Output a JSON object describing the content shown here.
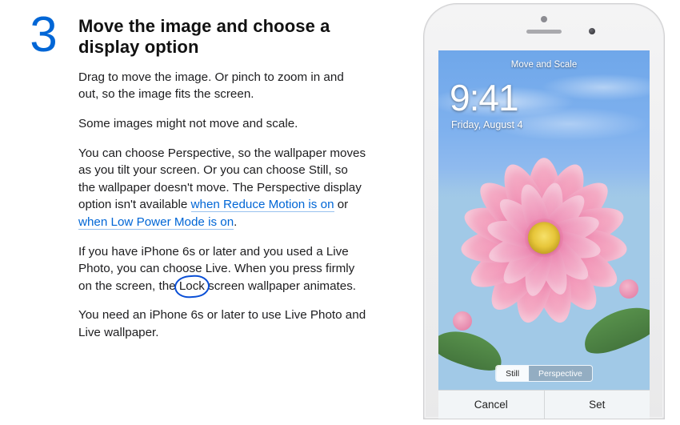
{
  "step": {
    "number": "3",
    "heading": "Move the image and choose a display option"
  },
  "paragraphs": {
    "p1": "Drag to move the image. Or pinch to zoom in and out, so the image fits the screen.",
    "p2": "Some images might not move and scale.",
    "p3_a": "You can choose Perspective, so the wallpaper moves as you tilt your screen. Or you can choose Still, so the wallpaper doesn't move. The Perspective display option isn't available ",
    "p3_link1": "when Reduce Motion is on",
    "p3_b": " or ",
    "p3_link2": "when Low Power Mode is on",
    "p3_c": ".",
    "p4_a": "If you have iPhone 6s or later and you used a Live Photo, you can choose Live. When you press firmly on the screen, the ",
    "p4_circled": "Lock",
    "p4_b": " screen wallpaper animates.",
    "p5": "You need an iPhone 6s or later to use Live Photo and Live wallpaper."
  },
  "phone": {
    "screen_title": "Move and Scale",
    "time": "9:41",
    "date": "Friday, August 4",
    "segmented": {
      "still": "Still",
      "perspective": "Perspective"
    },
    "toolbar": {
      "cancel": "Cancel",
      "set": "Set"
    }
  }
}
